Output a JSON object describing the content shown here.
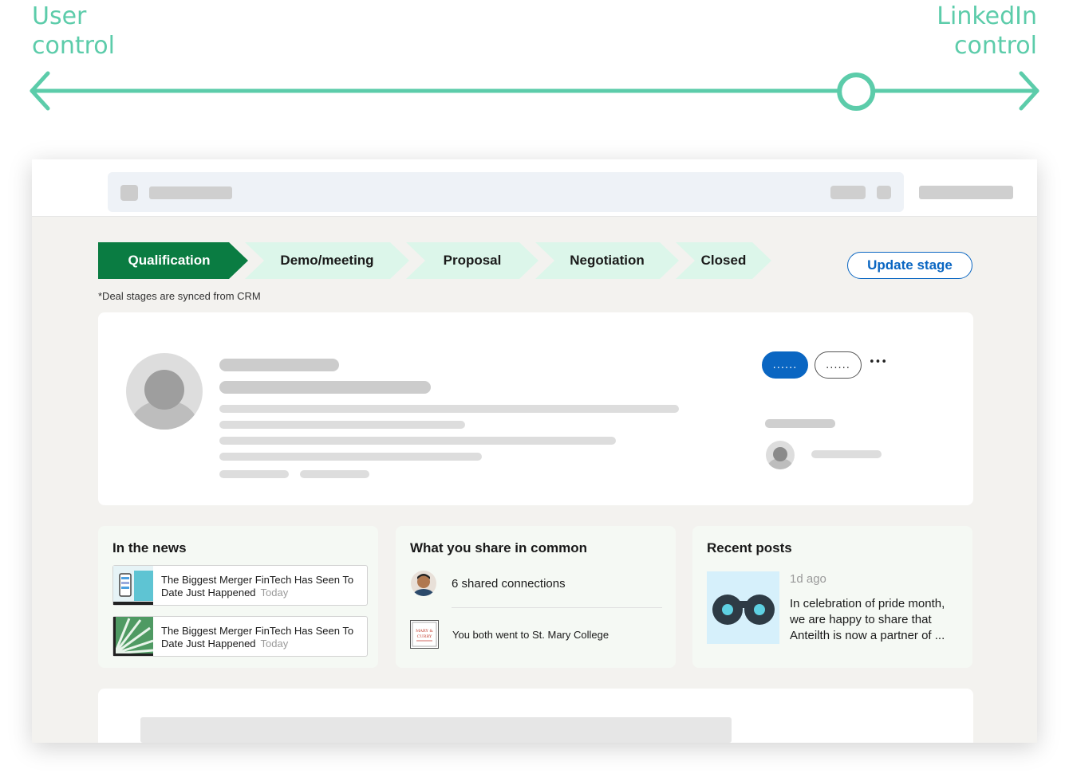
{
  "scale": {
    "left_label_line1": "User",
    "left_label_line2": "control",
    "right_label_line1": "LinkedIn",
    "right_label_line2": "control",
    "color": "#5cccaa",
    "level": 0.82
  },
  "stages": {
    "items": [
      {
        "label": "Qualification",
        "active": true
      },
      {
        "label": "Demo/meeting",
        "active": false
      },
      {
        "label": "Proposal",
        "active": false
      },
      {
        "label": "Negotiation",
        "active": false
      },
      {
        "label": "Closed",
        "active": false
      }
    ],
    "update_button": "Update stage",
    "sync_note": "*Deal stages are synced from CRM",
    "active_color": "#0a7c42",
    "inactive_color": "#dcf6ea"
  },
  "profile": {
    "primary_button": "......",
    "secondary_button": "......",
    "more_label": "•••",
    "accent_color": "#0a66c2"
  },
  "news": {
    "title": "In the news",
    "items": [
      {
        "headline": "The Biggest Merger FinTech Has Seen To Date Just Happened",
        "time": "Today"
      },
      {
        "headline": "The Biggest Merger FinTech Has Seen To Date Just Happened",
        "time": "Today"
      }
    ]
  },
  "common": {
    "title": "What you share in common",
    "connections": "6 shared connections",
    "school": "You both went to St. Mary College",
    "school_logo_line1": "MARY &",
    "school_logo_line2": "CURRY"
  },
  "posts": {
    "title": "Recent posts",
    "time": "1d ago",
    "text": "In celebration of pride month, we are happy to share that Anteilth is now a partner of ..."
  }
}
